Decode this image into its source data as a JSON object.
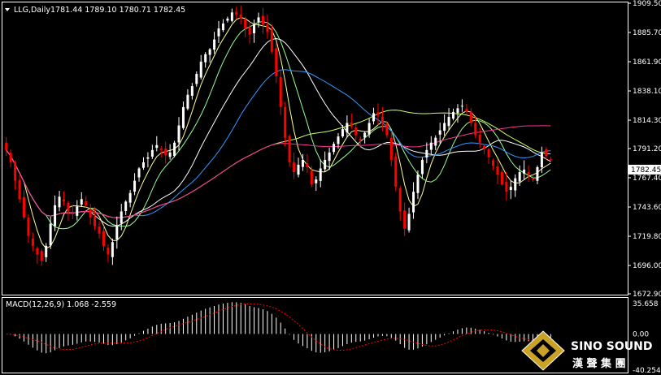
{
  "header": {
    "symbol_label": "LLG,Daily",
    "ohlc": "1781.44 1789.10 1780.71 1782.45"
  },
  "current_price": "1782.45",
  "price_axis_labels": [
    "1909.50",
    "1885.70",
    "1861.90",
    "1838.10",
    "1814.30",
    "1791.20",
    "1767.40",
    "1743.60",
    "1719.80",
    "1696.00",
    "1672.90"
  ],
  "macd": {
    "label": "MACD(12,26,9) 1.068 -2.559",
    "axis_labels": [
      "35.658",
      "0.00",
      "-40.254"
    ]
  },
  "watermark": {
    "brand": "SINO SOUND",
    "chinese": "漢 聲 集 團"
  },
  "colors": {
    "background": "#000000",
    "bull_candle": "#ffffff",
    "bear_candle": "#ff0000",
    "axis": "#ffffff",
    "ma_lines": [
      "#ffff99",
      "#99ff99",
      "#ffffff",
      "#3399ff",
      "#ccff66",
      "#ff3399"
    ],
    "macd_hist": "#ffffff",
    "macd_signal": "#ff0000",
    "price_tag_bg": "#ffffff"
  },
  "chart_data": {
    "type": "candlestick",
    "timeframe": "daily",
    "price_axis": {
      "min": 1672.9,
      "max": 1909.5,
      "ticks": [
        1909.5,
        1885.7,
        1861.9,
        1838.1,
        1814.3,
        1791.2,
        1767.4,
        1743.6,
        1719.8,
        1696.0,
        1672.9
      ]
    },
    "close": [
      1790,
      1780,
      1765,
      1750,
      1735,
      1720,
      1712,
      1705,
      1700,
      1712,
      1730,
      1745,
      1752,
      1748,
      1740,
      1738,
      1744,
      1750,
      1745,
      1735,
      1728,
      1722,
      1712,
      1705,
      1715,
      1728,
      1740,
      1748,
      1755,
      1765,
      1775,
      1780,
      1784,
      1790,
      1794,
      1790,
      1786,
      1788,
      1796,
      1810,
      1825,
      1835,
      1842,
      1852,
      1862,
      1868,
      1872,
      1880,
      1889,
      1893,
      1897,
      1902,
      1900,
      1897,
      1889,
      1884,
      1892,
      1898,
      1892,
      1886,
      1870,
      1850,
      1825,
      1800,
      1780,
      1772,
      1778,
      1782,
      1776,
      1762,
      1766,
      1775,
      1782,
      1788,
      1795,
      1801,
      1807,
      1812,
      1809,
      1802,
      1798,
      1804,
      1812,
      1820,
      1818,
      1812,
      1802,
      1782,
      1760,
      1740,
      1726,
      1738,
      1756,
      1770,
      1782,
      1790,
      1796,
      1800,
      1806,
      1812,
      1817,
      1821,
      1824,
      1826,
      1821,
      1812,
      1802,
      1796,
      1791,
      1784,
      1777,
      1770,
      1762,
      1756,
      1760,
      1767,
      1772,
      1774,
      1770,
      1766,
      1776,
      1788,
      1785,
      1782
    ],
    "ma_series": 6,
    "indicators": {
      "macd": {
        "fast": 12,
        "slow": 26,
        "signal": 9,
        "main": 1.068,
        "signal_value": -2.559,
        "axis": {
          "max": 35.658,
          "zero": 0.0,
          "min": -40.254
        }
      }
    },
    "last": {
      "open": 1781.44,
      "high": 1789.1,
      "low": 1780.71,
      "close": 1782.45
    }
  }
}
